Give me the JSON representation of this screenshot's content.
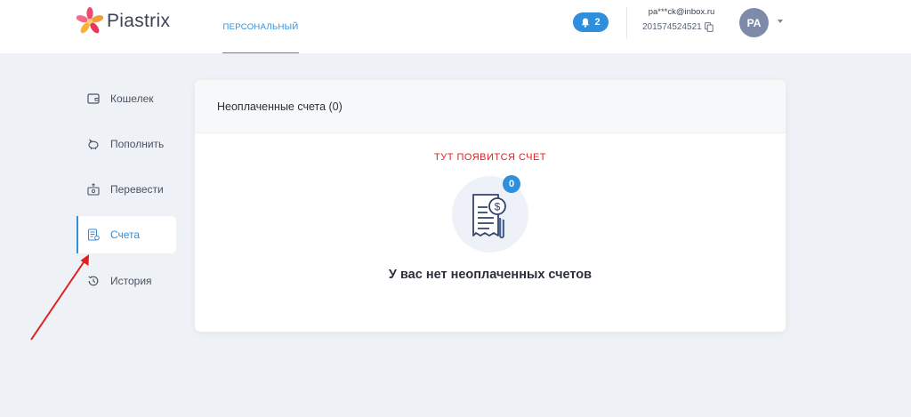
{
  "header": {
    "brand": "Piastrix",
    "nav_tab": "ПЕРСОНАЛЬНЫЙ",
    "notifications_count": "2",
    "email": "pa***ck@inbox.ru",
    "account_number": "201574524521",
    "avatar_initials": "PA"
  },
  "sidebar": {
    "items": [
      {
        "label": "Кошелек",
        "icon": "wallet-icon"
      },
      {
        "label": "Пополнить",
        "icon": "piggy-bank-icon"
      },
      {
        "label": "Перевести",
        "icon": "transfer-icon"
      },
      {
        "label": "Счета",
        "icon": "invoice-icon",
        "active": true
      },
      {
        "label": "История",
        "icon": "history-icon"
      }
    ]
  },
  "main": {
    "card_title": "Неоплаченные счета (0)",
    "hint": "ТУТ ПОЯВИТСЯ СЧЕТ",
    "badge_count": "0",
    "empty_message": "У вас нет неоплаченных счетов"
  },
  "colors": {
    "accent": "#2f8fdd",
    "annotation_red": "#e02020",
    "background": "#eef1f5"
  }
}
